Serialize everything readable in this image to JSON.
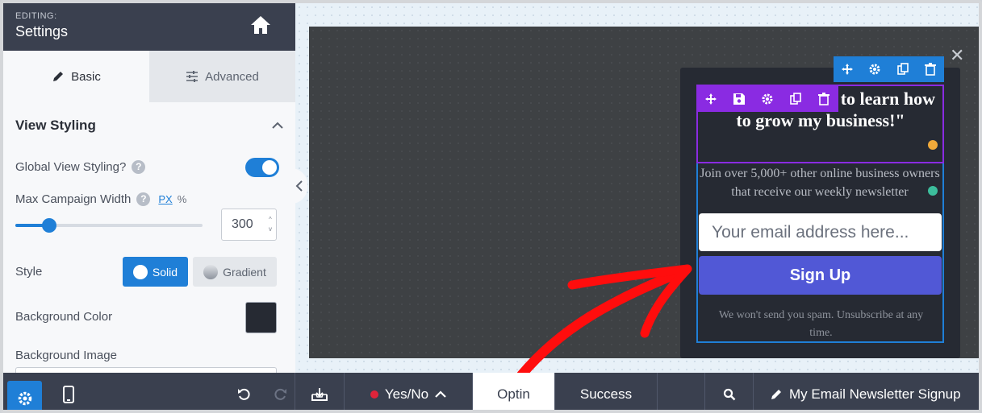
{
  "header": {
    "sub_label": "EDITING:",
    "title": "Settings"
  },
  "tabs": [
    {
      "label": "Basic",
      "active": true
    },
    {
      "label": "Advanced",
      "active": false
    }
  ],
  "section": {
    "title": "View Styling"
  },
  "settings": {
    "global_view_styling": {
      "label": "Global View Styling?",
      "enabled": true
    },
    "max_width": {
      "label": "Max Campaign Width",
      "unit_px": "PX",
      "unit_pct": "%",
      "value": "300",
      "slider_fraction": 0.18
    },
    "style": {
      "label": "Style",
      "solid": "Solid",
      "gradient": "Gradient",
      "selected": "Solid"
    },
    "bg_color": {
      "label": "Background Color",
      "value": "#262a33"
    },
    "bg_image": {
      "label": "Background Image"
    }
  },
  "help_glyph": "?",
  "popup": {
    "close": "✕",
    "headline": "email every week to learn how to grow my business!\"",
    "subtext": "Join over 5,000+ other online business owners that receive our weekly newsletter",
    "email_placeholder": "Your email address here...",
    "button_label": "Sign Up",
    "disclaimer": "We won't send you spam. Unsubscribe at any time."
  },
  "bottom_bar": {
    "yes_no": "Yes/No",
    "optin": "Optin",
    "success": "Success",
    "campaign_name": "My Email Newsletter Signup"
  },
  "colors": {
    "accent_blue": "#1f7fd7",
    "purple": "#8a2be2",
    "button": "#5158d6",
    "arrow_red": "#ff0d0d"
  }
}
